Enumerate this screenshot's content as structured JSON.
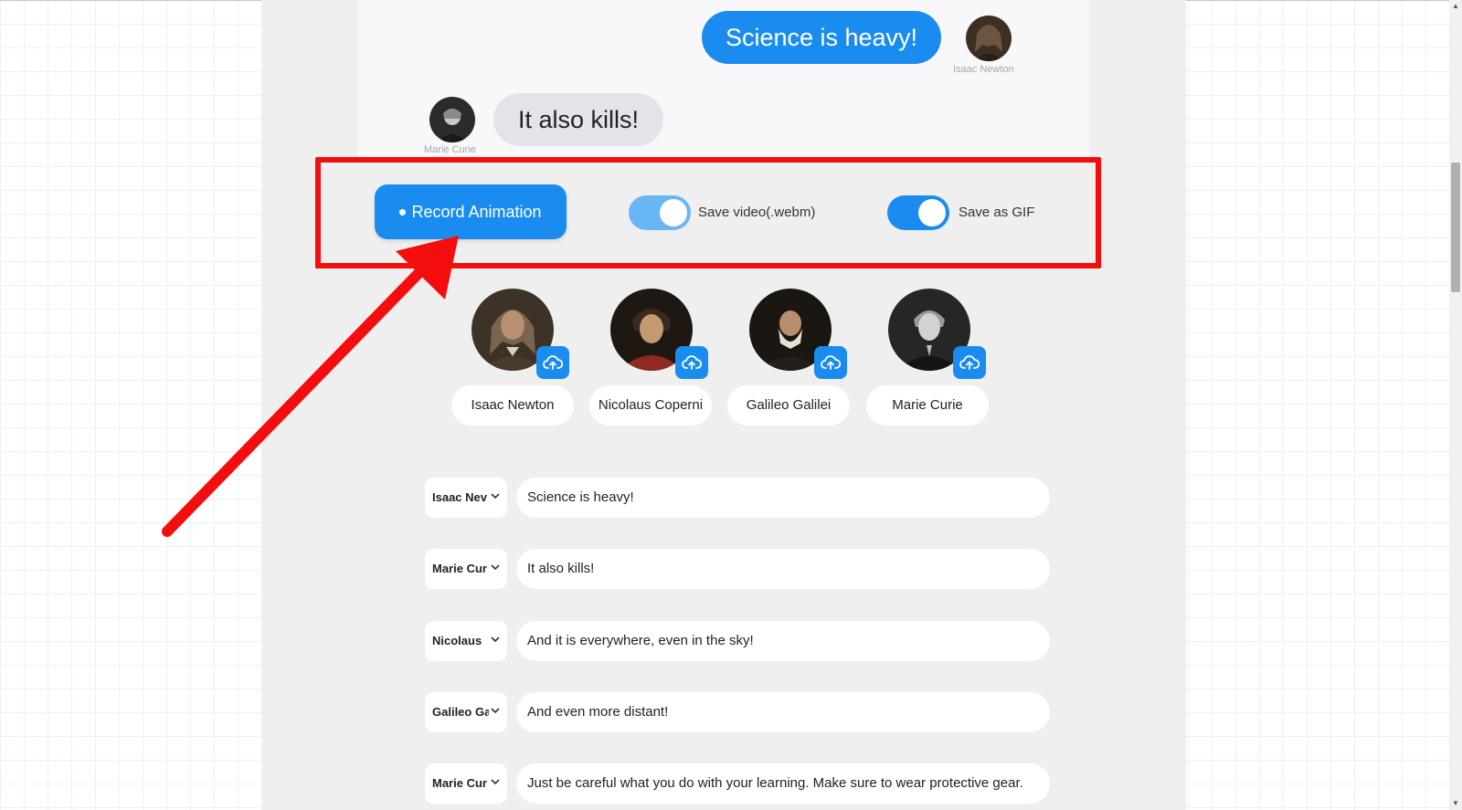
{
  "chat_preview": {
    "messages": [
      {
        "speaker": "Isaac Newton",
        "text": "Science is heavy!",
        "side": "right"
      },
      {
        "speaker": "Marie Curie",
        "text": "It also kills!",
        "side": "left"
      }
    ]
  },
  "controls": {
    "record_label": "Record Animation",
    "toggles": [
      {
        "label": "Save video(.webm)",
        "on": true,
        "color": "#69b6f5"
      },
      {
        "label": "Save as GIF",
        "on": true,
        "color": "#1a8cf0"
      }
    ]
  },
  "characters": [
    {
      "name": "Isaac Newton",
      "pill_text": "Isaac Newton",
      "icon": "cloud-upload-icon"
    },
    {
      "name": "Nicolaus Copernicus",
      "pill_text": "Nicolaus Coperni",
      "icon": "cloud-upload-icon"
    },
    {
      "name": "Galileo Galilei",
      "pill_text": "Galileo Galilei",
      "icon": "cloud-upload-icon"
    },
    {
      "name": "Marie Curie",
      "pill_text": "Marie Curie",
      "icon": "cloud-upload-icon"
    }
  ],
  "script_lines": [
    {
      "speaker": "Isaac Nev",
      "text": "Science is heavy!"
    },
    {
      "speaker": "Marie Cur",
      "text": "It also kills!"
    },
    {
      "speaker": "Nicolaus",
      "text": "And it is everywhere, even in the sky!"
    },
    {
      "speaker": "Galileo Ga",
      "text": "And even more distant!"
    },
    {
      "speaker": "Marie Cur",
      "text": "Just be careful what you do with your learning. Make sure to wear protective gear."
    }
  ],
  "colors": {
    "accent": "#1a8cf0",
    "annotation": "#f40d0d",
    "panel": "#efefef"
  },
  "icons": {
    "upload": "cloud-upload-icon",
    "dropdown": "chevron-down-icon"
  }
}
